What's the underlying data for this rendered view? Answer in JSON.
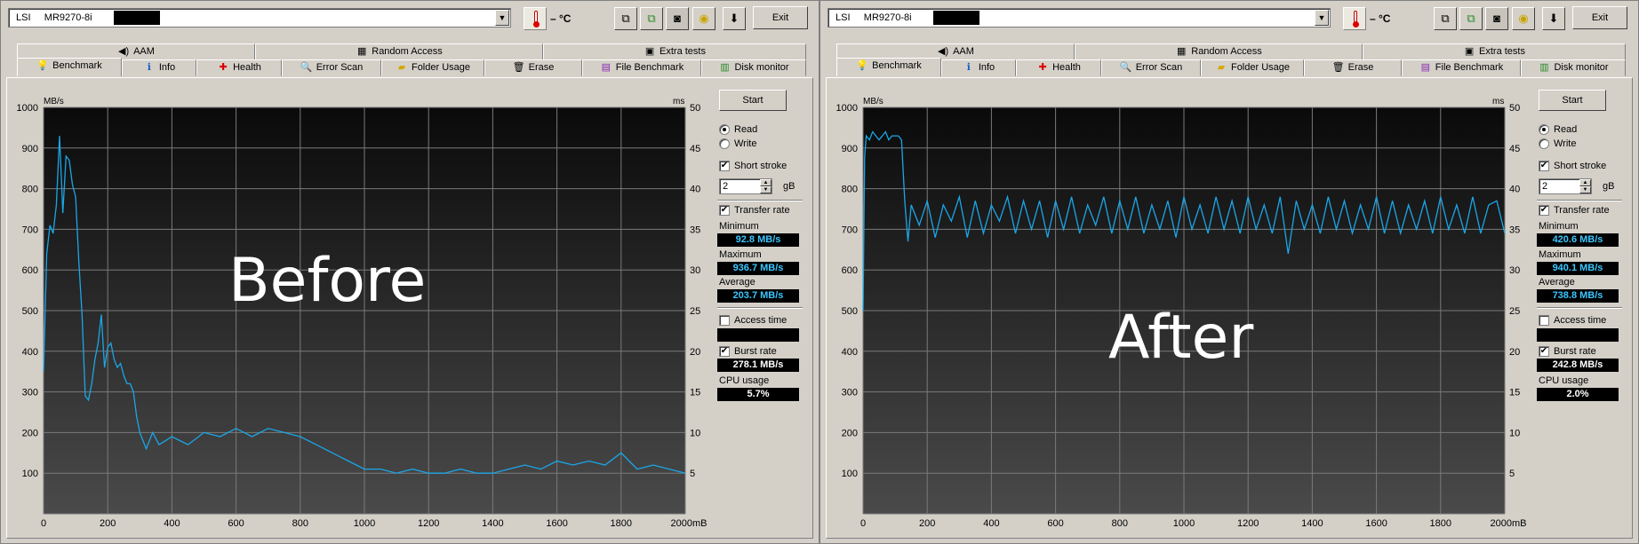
{
  "common": {
    "drive_label": "LSI     MR9270-8i",
    "temperature": "– °C",
    "exit_label": "Exit",
    "tabs_top": [
      {
        "label": "AAM",
        "icon": "speaker-icon"
      },
      {
        "label": "Random Access",
        "icon": "random-access-icon"
      },
      {
        "label": "Extra tests",
        "icon": "extra-tests-icon"
      }
    ],
    "tabs_bottom": [
      {
        "label": "Benchmark",
        "icon": "lightbulb-icon"
      },
      {
        "label": "Info",
        "icon": "info-icon"
      },
      {
        "label": "Health",
        "icon": "health-cross-icon"
      },
      {
        "label": "Error Scan",
        "icon": "magnifier-icon"
      },
      {
        "label": "Folder Usage",
        "icon": "folder-icon"
      },
      {
        "label": "Erase",
        "icon": "trash-icon"
      },
      {
        "label": "File Benchmark",
        "icon": "file-benchmark-icon"
      },
      {
        "label": "Disk monitor",
        "icon": "disk-monitor-icon"
      }
    ],
    "start_label": "Start",
    "read_label": "Read",
    "write_label": "Write",
    "short_stroke_label": "Short stroke",
    "stroke_value": "2",
    "stroke_unit": "gB",
    "transfer_rate_label": "Transfer rate",
    "minimum_label": "Minimum",
    "maximum_label": "Maximum",
    "average_label": "Average",
    "access_time_label": "Access time",
    "burst_rate_label": "Burst rate",
    "cpu_usage_label": "CPU usage",
    "read_selected": true,
    "short_stroke_checked": true,
    "transfer_rate_checked": true,
    "access_time_checked": false,
    "burst_rate_checked": true
  },
  "panels": [
    {
      "overlay_text": "Before",
      "minimum": "92.8 MB/s",
      "maximum": "936.7 MB/s",
      "average": "203.7 MB/s",
      "access_time": "",
      "burst_rate": "278.1 MB/s",
      "cpu_usage": "5.7%"
    },
    {
      "overlay_text": "After",
      "minimum": "420.6 MB/s",
      "maximum": "940.1 MB/s",
      "average": "738.8 MB/s",
      "access_time": "",
      "burst_rate": "242.8 MB/s",
      "cpu_usage": "2.0%"
    }
  ],
  "chart_data": [
    {
      "type": "line",
      "title": "",
      "xlabel": "mB",
      "ylabel": "MB/s",
      "y2label": "ms",
      "xlim": [
        0,
        2000
      ],
      "ylim": [
        0,
        1000
      ],
      "y2lim": [
        0,
        50
      ],
      "x_ticks": [
        "0",
        "200",
        "400",
        "600",
        "800",
        "1000",
        "1200",
        "1400",
        "1600",
        "1800",
        "2000mB"
      ],
      "y_ticks": [
        "100",
        "200",
        "300",
        "400",
        "500",
        "600",
        "700",
        "800",
        "900",
        "1000"
      ],
      "y2_ticks": [
        "5",
        "10",
        "15",
        "20",
        "25",
        "30",
        "35",
        "40",
        "45",
        "50"
      ],
      "grid": true,
      "series_color": "#1aa6e8",
      "series": [
        {
          "name": "",
          "x": [
            0,
            10,
            20,
            30,
            40,
            50,
            60,
            70,
            80,
            90,
            100,
            110,
            120,
            130,
            140,
            150,
            160,
            170,
            180,
            190,
            200,
            210,
            220,
            230,
            240,
            250,
            260,
            270,
            280,
            290,
            300,
            320,
            340,
            360,
            380,
            400,
            450,
            500,
            550,
            600,
            650,
            700,
            750,
            800,
            850,
            900,
            950,
            1000,
            1050,
            1100,
            1150,
            1200,
            1250,
            1300,
            1350,
            1400,
            1450,
            1500,
            1550,
            1600,
            1650,
            1700,
            1750,
            1800,
            1850,
            1900,
            1950,
            2000
          ],
          "y": [
            350,
            640,
            710,
            690,
            760,
            930,
            740,
            880,
            870,
            810,
            780,
            620,
            490,
            290,
            280,
            320,
            380,
            420,
            490,
            360,
            410,
            420,
            380,
            360,
            370,
            340,
            320,
            320,
            300,
            240,
            200,
            160,
            200,
            170,
            180,
            190,
            170,
            200,
            190,
            210,
            190,
            210,
            200,
            190,
            170,
            150,
            130,
            110,
            110,
            100,
            110,
            100,
            100,
            110,
            100,
            100,
            110,
            120,
            110,
            130,
            120,
            130,
            120,
            150,
            110,
            120,
            110,
            100
          ]
        }
      ]
    },
    {
      "type": "line",
      "title": "",
      "xlabel": "mB",
      "ylabel": "MB/s",
      "y2label": "ms",
      "xlim": [
        0,
        2000
      ],
      "ylim": [
        0,
        1000
      ],
      "y2lim": [
        0,
        50
      ],
      "x_ticks": [
        "0",
        "200",
        "400",
        "600",
        "800",
        "1000",
        "1200",
        "1400",
        "1600",
        "1800",
        "2000mB"
      ],
      "y_ticks": [
        "100",
        "200",
        "300",
        "400",
        "500",
        "600",
        "700",
        "800",
        "900",
        "1000"
      ],
      "y2_ticks": [
        "5",
        "10",
        "15",
        "20",
        "25",
        "30",
        "35",
        "40",
        "45",
        "50"
      ],
      "grid": true,
      "series_color": "#1aa6e8",
      "series": [
        {
          "name": "",
          "x": [
            0,
            5,
            10,
            20,
            30,
            40,
            50,
            60,
            70,
            80,
            90,
            100,
            110,
            120,
            130,
            140,
            150,
            175,
            200,
            225,
            250,
            275,
            300,
            325,
            350,
            375,
            400,
            425,
            450,
            475,
            500,
            525,
            550,
            575,
            600,
            625,
            650,
            675,
            700,
            725,
            750,
            775,
            800,
            825,
            850,
            875,
            900,
            925,
            950,
            975,
            1000,
            1025,
            1050,
            1075,
            1100,
            1125,
            1150,
            1175,
            1200,
            1225,
            1250,
            1275,
            1300,
            1325,
            1350,
            1375,
            1400,
            1425,
            1450,
            1475,
            1500,
            1525,
            1550,
            1575,
            1600,
            1625,
            1650,
            1675,
            1700,
            1725,
            1750,
            1775,
            1800,
            1825,
            1850,
            1875,
            1900,
            1925,
            1950,
            1975,
            2000
          ],
          "y": [
            500,
            880,
            930,
            920,
            940,
            930,
            920,
            930,
            940,
            920,
            930,
            930,
            930,
            920,
            770,
            670,
            760,
            710,
            770,
            680,
            760,
            720,
            780,
            680,
            770,
            690,
            760,
            720,
            780,
            690,
            770,
            700,
            770,
            680,
            770,
            700,
            780,
            690,
            760,
            710,
            780,
            690,
            770,
            700,
            780,
            690,
            760,
            700,
            770,
            680,
            780,
            700,
            760,
            690,
            780,
            700,
            770,
            690,
            780,
            700,
            760,
            690,
            780,
            640,
            770,
            700,
            760,
            690,
            780,
            700,
            770,
            690,
            760,
            700,
            780,
            690,
            770,
            690,
            760,
            700,
            770,
            690,
            780,
            700,
            760,
            690,
            780,
            690,
            760,
            770,
            690
          ]
        }
      ]
    }
  ]
}
